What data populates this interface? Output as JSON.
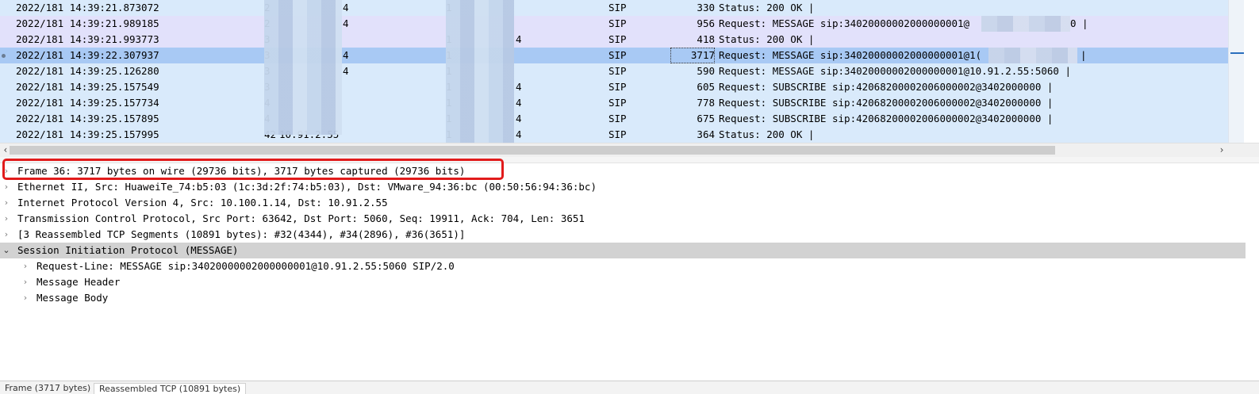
{
  "packet_list": {
    "rows": [
      {
        "time": "2022/181 14:39:21.873072",
        "src": "2",
        "src_tail": "4",
        "dst": "1",
        "proto": "SIP",
        "len": "330",
        "info": "Status: 200 OK |",
        "style": "c-sip"
      },
      {
        "time": "2022/181 14:39:21.989185",
        "src": "2",
        "src_tail": "4",
        "dst": "",
        "proto": "SIP",
        "len": "956",
        "info": "Request: MESSAGE sip:34020000002000000001@",
        "info_tail": "0 |",
        "style": "c-msg"
      },
      {
        "time": "2022/181 14:39:21.993773",
        "src": "3",
        "src_tail": "",
        "dst": "1",
        "dst_tail": "4",
        "proto": "SIP",
        "len": "418",
        "info": "Status: 200 OK |",
        "style": "c-msg"
      },
      {
        "time": "2022/181 14:39:22.307937",
        "src": "3",
        "src_tail": "4",
        "dst": "1",
        "proto": "SIP",
        "len": "3717",
        "info": "Request: MESSAGE sip:34020000002000000001@1(",
        "info_tail": "|",
        "style": "c-sel",
        "selected": true
      },
      {
        "time": "2022/181 14:39:25.126280",
        "src": "3",
        "src_tail": "4",
        "dst": "1",
        "proto": "SIP",
        "len": "590",
        "info": "Request: MESSAGE sip:34020000002000000001@10.91.2.55:5060 |",
        "style": "c-sip"
      },
      {
        "time": "2022/181 14:39:25.157549",
        "src": "3",
        "src_tail": "",
        "dst": "1",
        "dst_tail": "4",
        "proto": "SIP",
        "len": "605",
        "info": "Request: SUBSCRIBE sip:42068200002006000002@3402000000 |",
        "style": "c-sip"
      },
      {
        "time": "2022/181 14:39:25.157734",
        "src": "4",
        "src_tail": "",
        "dst": "1",
        "dst_tail": "4",
        "proto": "SIP",
        "len": "778",
        "info": "Request: SUBSCRIBE sip:42068200002006000002@3402000000 |",
        "style": "c-sip"
      },
      {
        "time": "2022/181 14:39:25.157895",
        "src": "4",
        "src_tail": "",
        "dst": "1",
        "dst_tail": "4",
        "proto": "SIP",
        "len": "675",
        "info": "Request: SUBSCRIBE sip:42068200002006000002@3402000000 |",
        "style": "c-sip"
      },
      {
        "time": "2022/181 14:39:25.157995",
        "src": "42",
        "src_tail": "10.91.2.55",
        "dst": "1",
        "dst_tail": "4",
        "proto": "SIP",
        "len": "364",
        "info": "Status: 200 OK |",
        "style": "c-sip"
      }
    ]
  },
  "details": {
    "frame": "Frame 36: 3717 bytes on wire (29736 bits), 3717 bytes captured (29736 bits)",
    "ethernet": "Ethernet II, Src: HuaweiTe_74:b5:03 (1c:3d:2f:74:b5:03), Dst: VMware_94:36:bc (00:50:56:94:36:bc)",
    "ip": "Internet Protocol Version 4, Src: 10.100.1.14, Dst: 10.91.2.55",
    "tcp": "Transmission Control Protocol, Src Port: 63642, Dst Port: 5060, Seq: 19911, Ack: 704, Len: 3651",
    "reassembled": "[3 Reassembled TCP Segments (10891 bytes): #32(4344), #34(2896), #36(3651)]",
    "sip": "Session Initiation Protocol (MESSAGE)",
    "sip_children": [
      "Request-Line: MESSAGE sip:34020000002000000001@10.91.2.55:5060 SIP/2.0",
      "Message Header",
      "Message Body"
    ]
  },
  "bytes_tabs": [
    "Frame (3717 bytes)",
    "Reassembled TCP (10891 bytes)"
  ],
  "colors": {
    "sip_row": "#d9eafb",
    "message_row": "#e2e1fb",
    "selected_row": "#a8c9f4",
    "expanded_row": "#d2d2d2",
    "annotation": "#e11b1b"
  },
  "icons": {
    "collapsed": "chevron-right-icon",
    "expanded": "chevron-down-icon",
    "scroll_left": "arrow-left-icon",
    "scroll_right": "arrow-right-icon"
  }
}
